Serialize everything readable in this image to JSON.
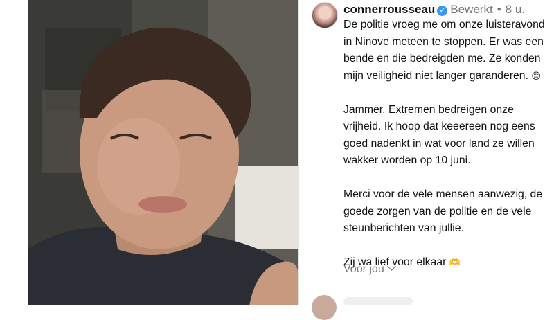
{
  "post": {
    "username": "connerrousseau",
    "edited_label": "Bewerkt",
    "separator": "•",
    "time": "8 u.",
    "caption": [
      "De politie vroeg me om onze luisteravond in Ninove meteen te stoppen. Er was een bende en die bedreigden me. Ze konden mijn veiligheid niet langer garanderen.",
      "Jammer. Extremen bedreigen onze vrijheid. Ik hoop dat keeereen nog eens goed nadenkt in wat voor land ze willen wakker worden op 10 juni.",
      "Merci voor de vele mensen aanwezig, de goede zorgen van de politie en de vele steunberichten van jullie.",
      "Zij wa lief voor elkaar"
    ],
    "emoji_1": "😔",
    "emoji_2": "🫶",
    "more_label": "Voor jou",
    "verified_mark": "✓"
  },
  "icons": {
    "verified": "verified-badge-icon",
    "chevron": "chevron-down-icon"
  },
  "colors": {
    "verified_blue": "#3897f0",
    "meta_gray": "#737373",
    "text": "#111111"
  }
}
